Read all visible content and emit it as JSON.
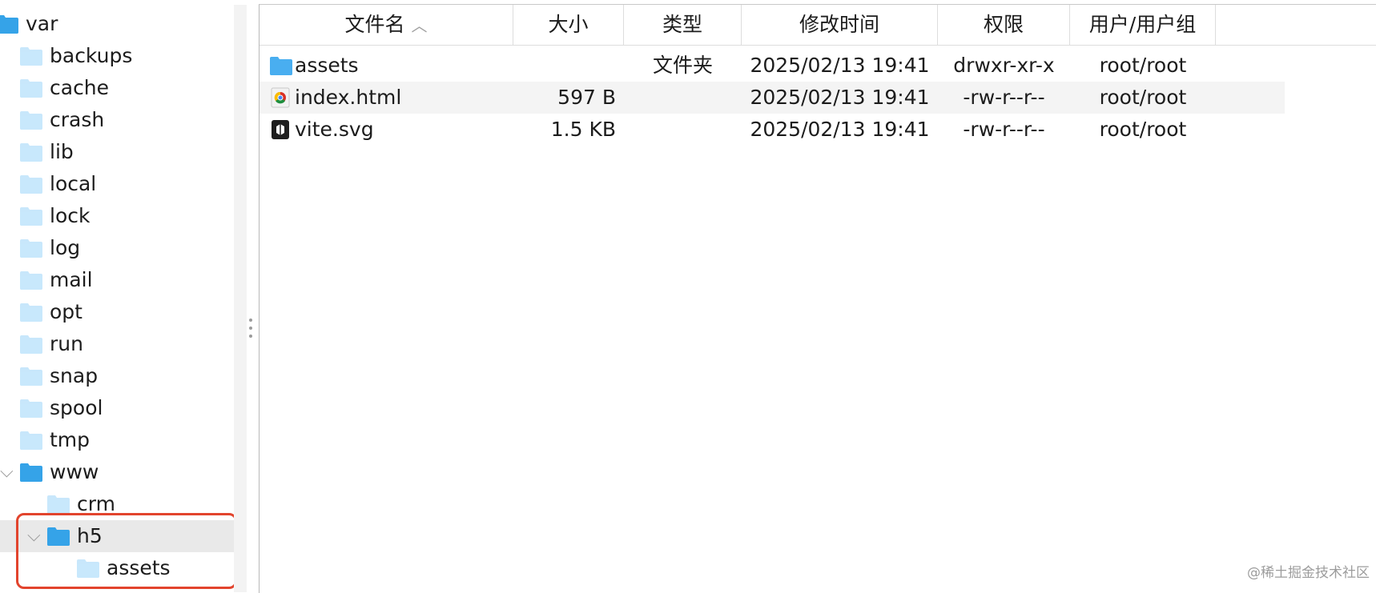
{
  "sidebar": {
    "items": [
      {
        "label": "var",
        "level": 0,
        "expanded": true
      },
      {
        "label": "backups",
        "level": 1
      },
      {
        "label": "cache",
        "level": 1
      },
      {
        "label": "crash",
        "level": 1
      },
      {
        "label": "lib",
        "level": 1
      },
      {
        "label": "local",
        "level": 1
      },
      {
        "label": "lock",
        "level": 1
      },
      {
        "label": "log",
        "level": 1
      },
      {
        "label": "mail",
        "level": 1
      },
      {
        "label": "opt",
        "level": 1
      },
      {
        "label": "run",
        "level": 1
      },
      {
        "label": "snap",
        "level": 1
      },
      {
        "label": "spool",
        "level": 1
      },
      {
        "label": "tmp",
        "level": 1
      },
      {
        "label": "www",
        "level": 1,
        "expanded": true
      },
      {
        "label": "crm",
        "level": 2
      },
      {
        "label": "h5",
        "level": 2,
        "expanded": true,
        "selected": true
      },
      {
        "label": "assets",
        "level": 3
      }
    ]
  },
  "table": {
    "columns": [
      {
        "key": "name",
        "label": "文件名",
        "sort_icon": "chevron-up-icon"
      },
      {
        "key": "size",
        "label": "大小"
      },
      {
        "key": "type",
        "label": "类型"
      },
      {
        "key": "mtime",
        "label": "修改时间"
      },
      {
        "key": "perm",
        "label": "权限"
      },
      {
        "key": "owner",
        "label": "用户/用户组"
      }
    ],
    "rows": [
      {
        "icon": "folder-icon",
        "name": "assets",
        "size": "",
        "type": "文件夹",
        "mtime": "2025/02/13 19:41",
        "perm": "drwxr-xr-x",
        "owner": "root/root"
      },
      {
        "icon": "chrome-html-icon",
        "name": "index.html",
        "size": "597 B",
        "type": "",
        "mtime": "2025/02/13 19:41",
        "perm": "-rw-r--r--",
        "owner": "root/root"
      },
      {
        "icon": "svg-file-icon",
        "name": "vite.svg",
        "size": "1.5 KB",
        "type": "",
        "mtime": "2025/02/13 19:41",
        "perm": "-rw-r--r--",
        "owner": "root/root"
      }
    ]
  },
  "watermark": "@稀土掘金技术社区",
  "colors": {
    "folder": "#7cc6f4",
    "highlight": "#e2442d",
    "selection": "#e9e9e9"
  }
}
